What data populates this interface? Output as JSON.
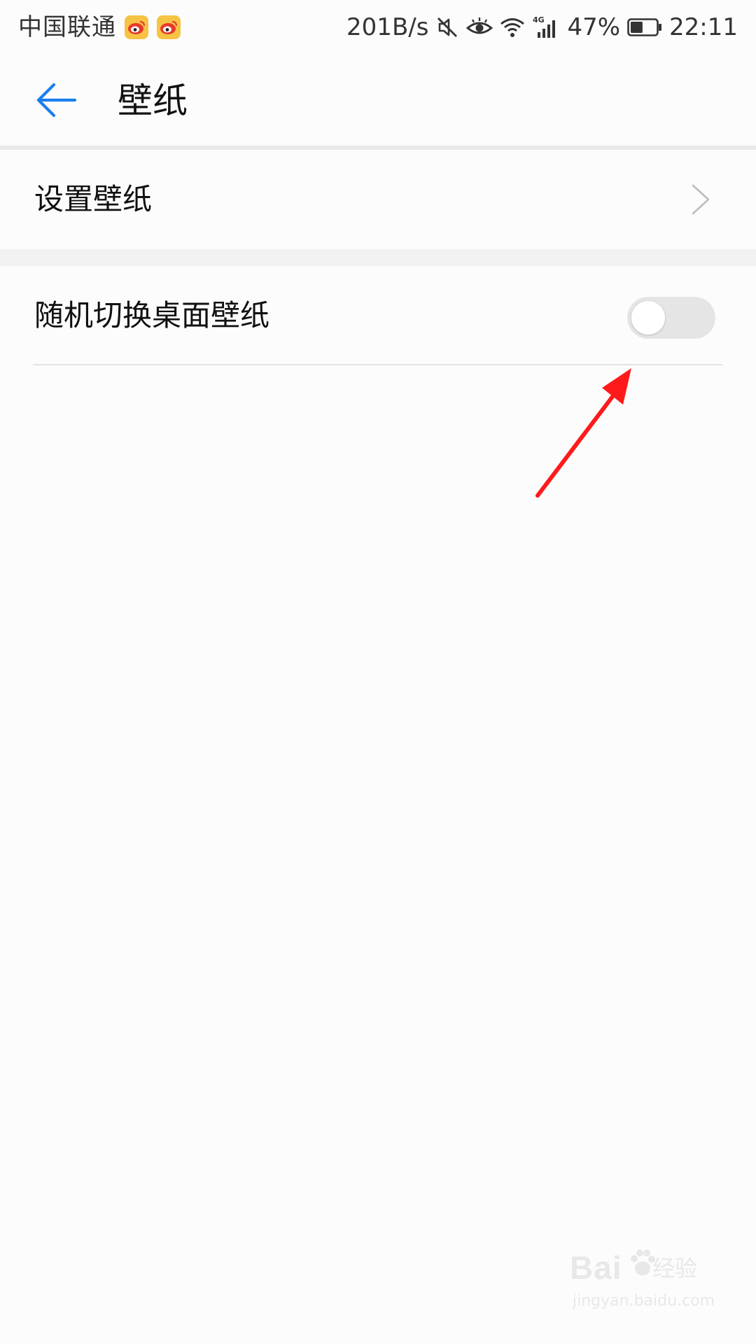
{
  "status_bar": {
    "carrier": "中国联通",
    "notification_icons": [
      "weibo-icon",
      "weibo-icon"
    ],
    "net_speed": "201B/s",
    "system_icons": [
      "mute-icon",
      "eye-comfort-icon",
      "wifi-icon",
      "signal-4g-icon"
    ],
    "network_type": "4G",
    "battery_percent_text": "47%",
    "battery_level": 0.47,
    "time": "22:11"
  },
  "header": {
    "back_icon": "back-arrow-icon",
    "title": "壁纸",
    "accent_color": "#1a7ff0"
  },
  "settings": {
    "set_wallpaper": {
      "label": "设置壁纸",
      "icon": "chevron-right-icon"
    },
    "random_switch": {
      "label": "随机切换桌面壁纸",
      "enabled": false
    }
  },
  "annotation": {
    "type": "arrow",
    "color": "#ff1a1a",
    "target": "random-wallpaper-toggle"
  },
  "watermark": {
    "brand": "Bai",
    "suffix": "经验",
    "url": "jingyan.baidu.com"
  }
}
